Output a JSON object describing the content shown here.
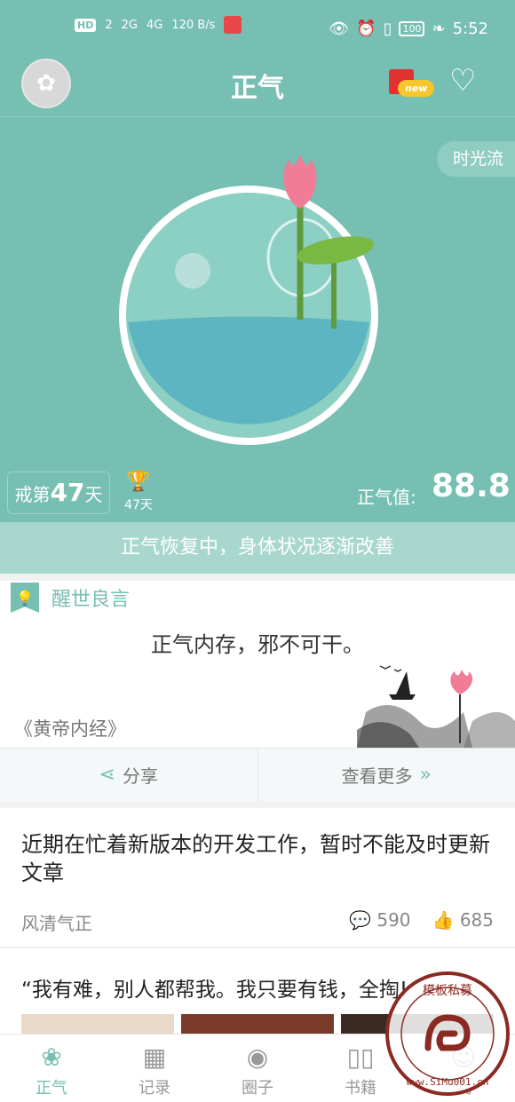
{
  "status_bar": {
    "left": [
      "HD",
      "2",
      "2G",
      "4G",
      "120 B/s"
    ],
    "battery": "100",
    "time": "5:52"
  },
  "header": {
    "title": "正气",
    "badge": "new"
  },
  "hero": {
    "time_flow": "时光流",
    "streak_prefix": "戒第",
    "streak_days": "47",
    "streak_suffix": "天",
    "record_days": "47天",
    "zhengqi_label": "正气值:",
    "zhengqi_value": "88.8",
    "status_message": "正气恢复中，身体状况逐渐改善"
  },
  "quote": {
    "section_label": "醒世良言",
    "text": "正气内存，邪不可干。",
    "source": "《黄帝内经》",
    "share_label": "分享",
    "more_label": "查看更多"
  },
  "articles": [
    {
      "title": "近期在忙着新版本的开发工作，暂时不能及时更新文章",
      "author": "风清气正",
      "comments": "590",
      "likes": "685"
    },
    {
      "title": "“我有难，别人都帮我。我只要有钱，全掏!"
    }
  ],
  "tabs": [
    {
      "label": "正气",
      "icon": "lotus-icon",
      "active": true
    },
    {
      "label": "记录",
      "icon": "calendar-icon",
      "active": false
    },
    {
      "label": "圈子",
      "icon": "broadcast-icon",
      "active": false
    },
    {
      "label": "书籍",
      "icon": "book-icon",
      "active": false
    },
    {
      "label": "我",
      "icon": "user-icon",
      "active": false
    }
  ],
  "watermark": {
    "text": "www.SiMu001.cn",
    "seal_chars": "模板私募"
  },
  "colors": {
    "primary": "#76bfb2",
    "hero_sub": "#a8d7ce",
    "lotus": "#f07c95",
    "water": "#5eb5c2"
  }
}
